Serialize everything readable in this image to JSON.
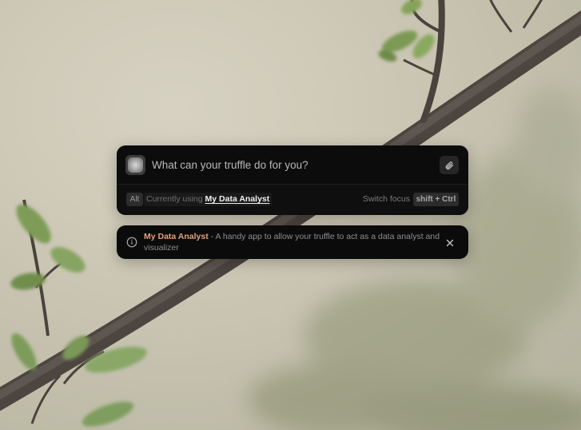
{
  "prompt": {
    "placeholder": "What can your truffle do for you?",
    "value": "",
    "attach_icon": "paperclip-icon",
    "avatar_icon": "truffle-orb-icon"
  },
  "status_bar": {
    "alt_key": "Alt",
    "current_label": "Currently using",
    "current_app": "My Data Analyst",
    "switch_focus_label": "Switch focus",
    "switch_focus_shortcut": "shift + Ctrl"
  },
  "notice": {
    "icon": "info-icon",
    "app_name": "My Data Analyst",
    "separator": " - ",
    "description": "A handy app to allow your truffle to act as a data analyst and visualizer",
    "close_icon": "close-icon"
  },
  "colors": {
    "panel_background": "#0c0c0c",
    "app_name_accent": "#e0a27a",
    "placeholder_text": "#b8b8b8"
  }
}
